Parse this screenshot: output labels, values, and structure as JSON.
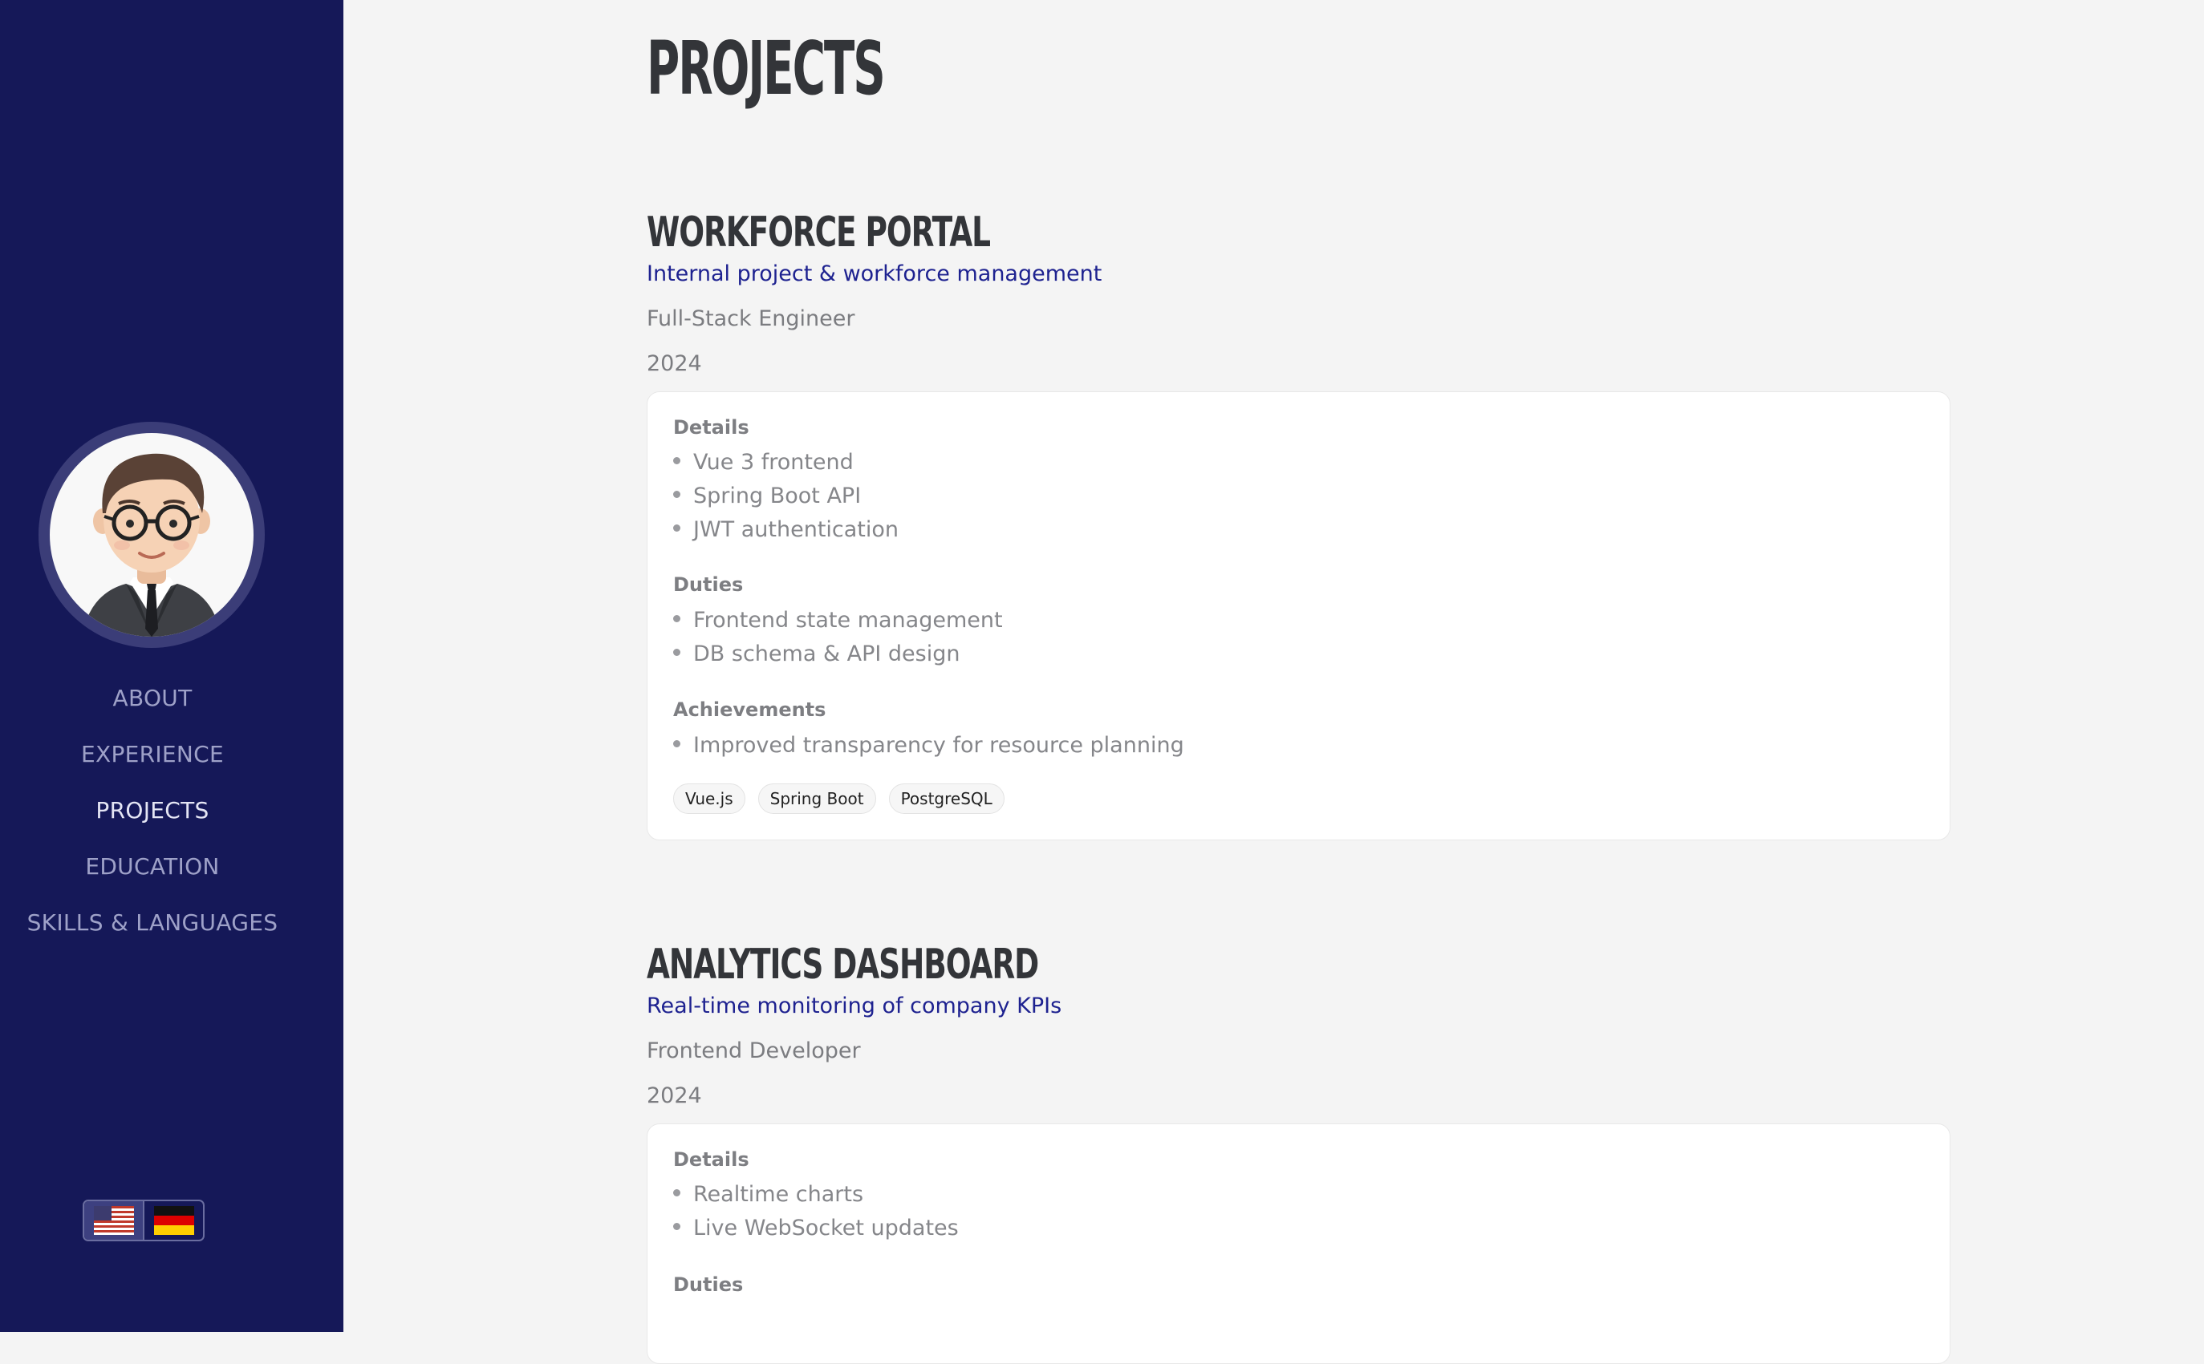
{
  "sidebar": {
    "nav": [
      "ABOUT",
      "EXPERIENCE",
      "PROJECTS",
      "EDUCATION",
      "SKILLS & LANGUAGES"
    ],
    "active": "PROJECTS",
    "languages": [
      {
        "icon": "us-flag-icon",
        "selected": true
      },
      {
        "icon": "de-flag-icon",
        "selected": false
      }
    ]
  },
  "main": {
    "title": "PROJECTS",
    "projects": [
      {
        "name": "WORKFORCE PORTAL",
        "subtitle": "Internal project & workforce management",
        "role": "Full-Stack Engineer",
        "year": "2024",
        "details_label": "Details",
        "details": [
          "Vue 3 frontend",
          "Spring Boot API",
          "JWT authentication"
        ],
        "duties_label": "Duties",
        "duties": [
          "Frontend state management",
          "DB schema & API design"
        ],
        "achievements_label": "Achievements",
        "achievements": [
          "Improved transparency for resource planning"
        ],
        "tags": [
          "Vue.js",
          "Spring Boot",
          "PostgreSQL"
        ]
      },
      {
        "name": "ANALYTICS DASHBOARD",
        "subtitle": "Real-time monitoring of company KPIs",
        "role": "Frontend Developer",
        "year": "2024",
        "details_label": "Details",
        "details": [
          "Realtime charts",
          "Live WebSocket updates"
        ],
        "duties_label": "Duties"
      }
    ]
  },
  "colors": {
    "sidebar_bg": "#151858",
    "page_bg": "#f4f4f4",
    "accent": "#1e2290",
    "heading": "#333539"
  }
}
